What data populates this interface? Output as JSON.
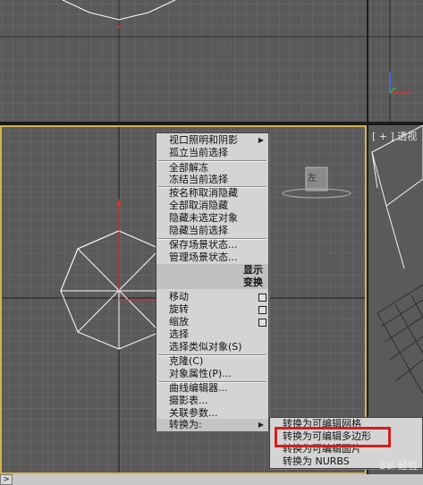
{
  "viewport_label": "[ + ] 透视",
  "context_menu": {
    "items": [
      {
        "label": "视口照明和阴影",
        "submenu": true
      },
      {
        "label": "孤立当前选择"
      },
      {
        "label": "全部解冻"
      },
      {
        "label": "冻结当前选择"
      },
      {
        "label": "按名称取消隐藏"
      },
      {
        "label": "全部取消隐藏"
      },
      {
        "label": "隐藏未选定对象"
      },
      {
        "label": "隐藏当前选择"
      },
      {
        "label": "保存场景状态..."
      },
      {
        "label": "管理场景状态..."
      }
    ],
    "display_header": "显示",
    "transform_header": "变换",
    "transform_items": [
      {
        "label": "移动",
        "options": true
      },
      {
        "label": "旋转",
        "options": true
      },
      {
        "label": "缩放",
        "options": true
      },
      {
        "label": "选择"
      },
      {
        "label": "选择类似对象(S)"
      },
      {
        "label": "克隆(C)"
      },
      {
        "label": "对象属性(P)..."
      },
      {
        "label": "曲线编辑器..."
      },
      {
        "label": "摄影表..."
      },
      {
        "label": "关联参数..."
      },
      {
        "label": "转换为:",
        "submenu": true
      }
    ]
  },
  "convert_submenu": {
    "items": [
      {
        "label": "转换为可编辑网格"
      },
      {
        "label": "转换为可编辑多边形"
      },
      {
        "label": "转换为可编辑面片"
      },
      {
        "label": "转换为 NURBS"
      }
    ],
    "highlighted_item": "转换为可编辑多边形"
  },
  "viewcube_label": "左",
  "watermark": "Bai 经验"
}
